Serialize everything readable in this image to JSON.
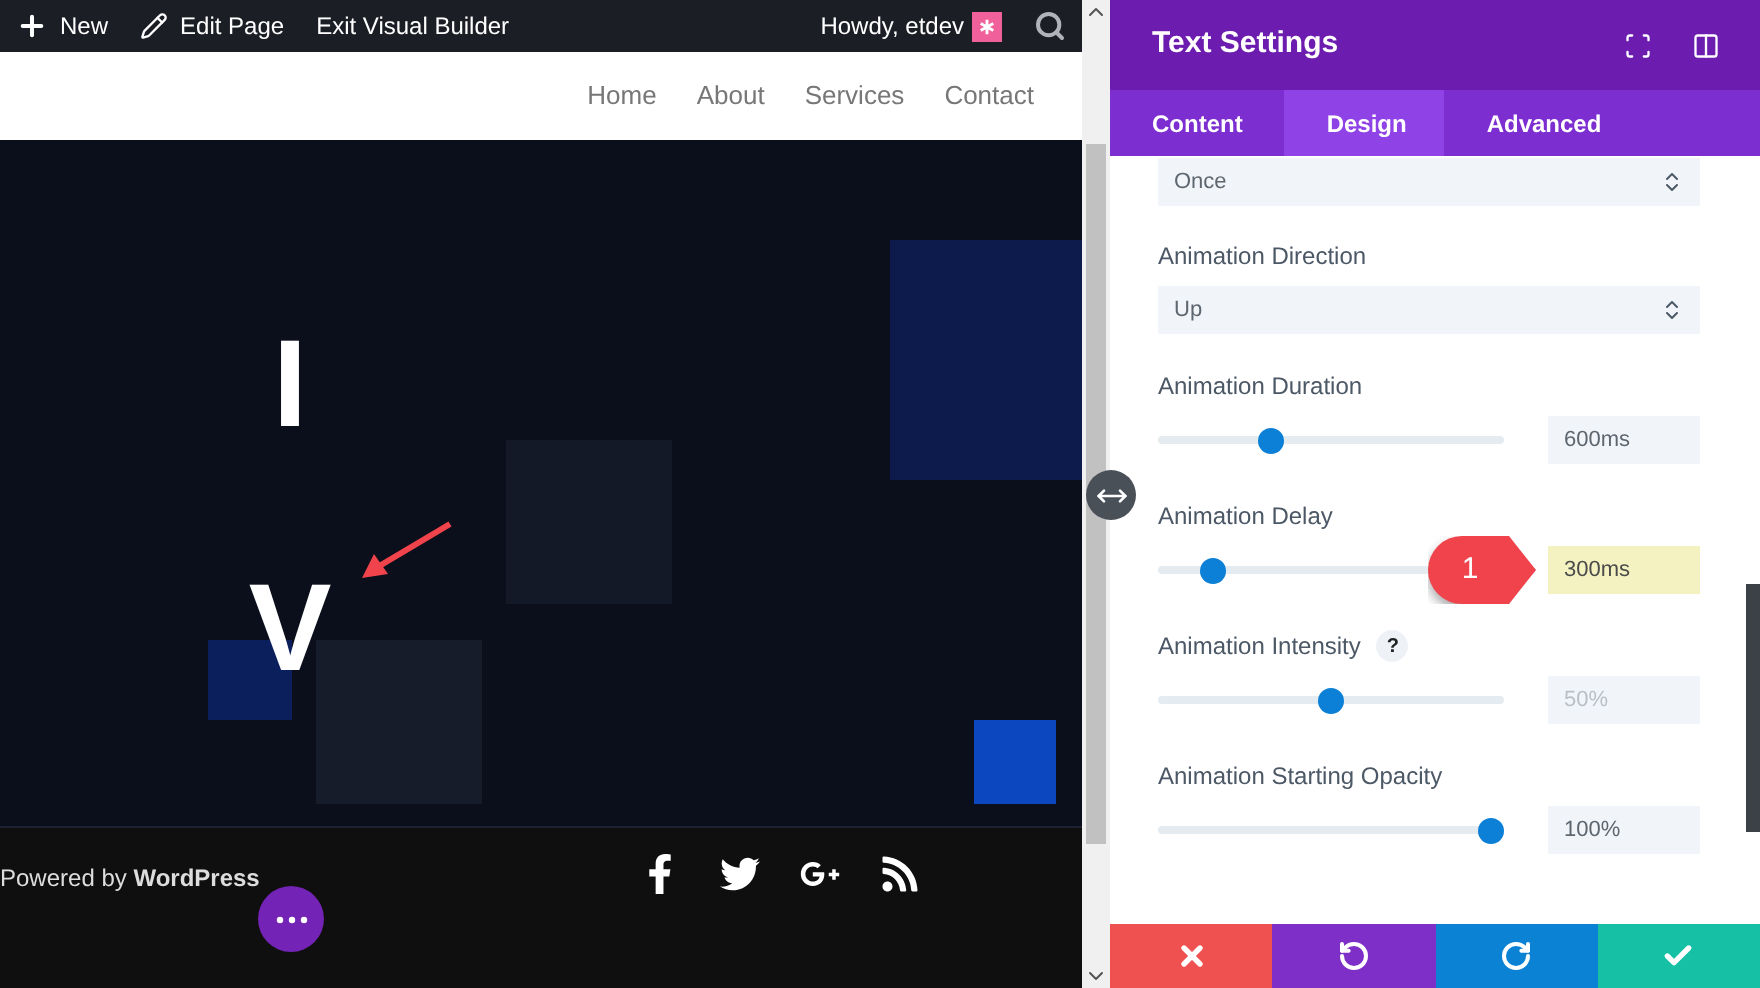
{
  "admin_bar": {
    "items": [
      {
        "kind": "new",
        "label": "New"
      },
      {
        "kind": "edit",
        "label": "Edit Page"
      },
      {
        "kind": "plain",
        "label": "Exit Visual Builder"
      }
    ],
    "greeting": "Howdy, etdev"
  },
  "nav": [
    {
      "label": "Home"
    },
    {
      "label": "About"
    },
    {
      "label": "Services"
    },
    {
      "label": "Contact"
    }
  ],
  "hero": {
    "letters": [
      "I",
      "V"
    ]
  },
  "footer": {
    "credit": "Powered by **WordPress**",
    "social": [
      {
        "kind": "facebook"
      },
      {
        "kind": "twitter"
      },
      {
        "kind": "google-plus"
      },
      {
        "kind": "rss"
      }
    ]
  },
  "panel": {
    "title": "Text Settings",
    "tabs": [
      {
        "label": "Content",
        "selected": false
      },
      {
        "label": "Design",
        "selected": true
      },
      {
        "label": "Advanced",
        "selected": false
      }
    ],
    "fields": [
      {
        "kind": "select",
        "value": "Once"
      },
      {
        "kind": "select",
        "label": "Animation Direction",
        "value": "Up"
      },
      {
        "kind": "slider",
        "label": "Animation Duration",
        "level": 0.31,
        "value": "600ms",
        "highlighted": false,
        "is_default": false
      },
      {
        "kind": "slider",
        "label": "Animation Delay",
        "level": 0.13,
        "value": "300ms",
        "highlighted": true,
        "is_default": false,
        "callout": "1"
      },
      {
        "kind": "slider",
        "label": "Animation Intensity",
        "help": "?",
        "level": 0.5,
        "value": "50%",
        "highlighted": false,
        "is_default": true
      },
      {
        "kind": "slider",
        "label": "Animation Starting Opacity",
        "level": 1,
        "value": "100%",
        "highlighted": false,
        "is_default": false
      }
    ]
  }
}
